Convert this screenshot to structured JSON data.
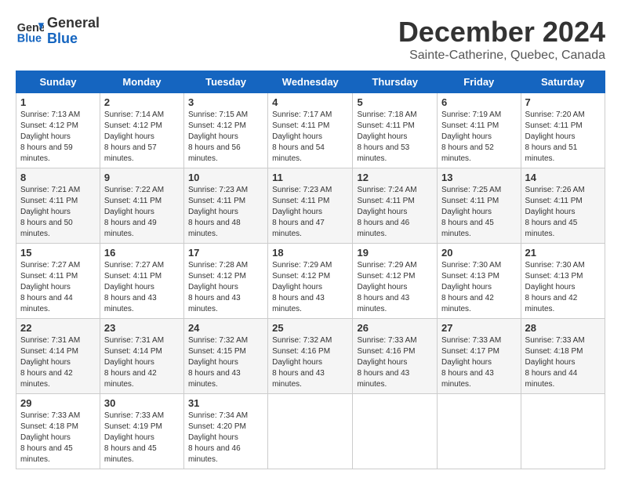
{
  "logo": {
    "line1": "General",
    "line2": "Blue"
  },
  "title": "December 2024",
  "location": "Sainte-Catherine, Quebec, Canada",
  "weekdays": [
    "Sunday",
    "Monday",
    "Tuesday",
    "Wednesday",
    "Thursday",
    "Friday",
    "Saturday"
  ],
  "weeks": [
    [
      {
        "day": "1",
        "sunrise": "7:13 AM",
        "sunset": "4:12 PM",
        "daylight": "8 hours and 59 minutes."
      },
      {
        "day": "2",
        "sunrise": "7:14 AM",
        "sunset": "4:12 PM",
        "daylight": "8 hours and 57 minutes."
      },
      {
        "day": "3",
        "sunrise": "7:15 AM",
        "sunset": "4:12 PM",
        "daylight": "8 hours and 56 minutes."
      },
      {
        "day": "4",
        "sunrise": "7:17 AM",
        "sunset": "4:11 PM",
        "daylight": "8 hours and 54 minutes."
      },
      {
        "day": "5",
        "sunrise": "7:18 AM",
        "sunset": "4:11 PM",
        "daylight": "8 hours and 53 minutes."
      },
      {
        "day": "6",
        "sunrise": "7:19 AM",
        "sunset": "4:11 PM",
        "daylight": "8 hours and 52 minutes."
      },
      {
        "day": "7",
        "sunrise": "7:20 AM",
        "sunset": "4:11 PM",
        "daylight": "8 hours and 51 minutes."
      }
    ],
    [
      {
        "day": "8",
        "sunrise": "7:21 AM",
        "sunset": "4:11 PM",
        "daylight": "8 hours and 50 minutes."
      },
      {
        "day": "9",
        "sunrise": "7:22 AM",
        "sunset": "4:11 PM",
        "daylight": "8 hours and 49 minutes."
      },
      {
        "day": "10",
        "sunrise": "7:23 AM",
        "sunset": "4:11 PM",
        "daylight": "8 hours and 48 minutes."
      },
      {
        "day": "11",
        "sunrise": "7:23 AM",
        "sunset": "4:11 PM",
        "daylight": "8 hours and 47 minutes."
      },
      {
        "day": "12",
        "sunrise": "7:24 AM",
        "sunset": "4:11 PM",
        "daylight": "8 hours and 46 minutes."
      },
      {
        "day": "13",
        "sunrise": "7:25 AM",
        "sunset": "4:11 PM",
        "daylight": "8 hours and 45 minutes."
      },
      {
        "day": "14",
        "sunrise": "7:26 AM",
        "sunset": "4:11 PM",
        "daylight": "8 hours and 45 minutes."
      }
    ],
    [
      {
        "day": "15",
        "sunrise": "7:27 AM",
        "sunset": "4:11 PM",
        "daylight": "8 hours and 44 minutes."
      },
      {
        "day": "16",
        "sunrise": "7:27 AM",
        "sunset": "4:11 PM",
        "daylight": "8 hours and 43 minutes."
      },
      {
        "day": "17",
        "sunrise": "7:28 AM",
        "sunset": "4:12 PM",
        "daylight": "8 hours and 43 minutes."
      },
      {
        "day": "18",
        "sunrise": "7:29 AM",
        "sunset": "4:12 PM",
        "daylight": "8 hours and 43 minutes."
      },
      {
        "day": "19",
        "sunrise": "7:29 AM",
        "sunset": "4:12 PM",
        "daylight": "8 hours and 43 minutes."
      },
      {
        "day": "20",
        "sunrise": "7:30 AM",
        "sunset": "4:13 PM",
        "daylight": "8 hours and 42 minutes."
      },
      {
        "day": "21",
        "sunrise": "7:30 AM",
        "sunset": "4:13 PM",
        "daylight": "8 hours and 42 minutes."
      }
    ],
    [
      {
        "day": "22",
        "sunrise": "7:31 AM",
        "sunset": "4:14 PM",
        "daylight": "8 hours and 42 minutes."
      },
      {
        "day": "23",
        "sunrise": "7:31 AM",
        "sunset": "4:14 PM",
        "daylight": "8 hours and 42 minutes."
      },
      {
        "day": "24",
        "sunrise": "7:32 AM",
        "sunset": "4:15 PM",
        "daylight": "8 hours and 43 minutes."
      },
      {
        "day": "25",
        "sunrise": "7:32 AM",
        "sunset": "4:16 PM",
        "daylight": "8 hours and 43 minutes."
      },
      {
        "day": "26",
        "sunrise": "7:33 AM",
        "sunset": "4:16 PM",
        "daylight": "8 hours and 43 minutes."
      },
      {
        "day": "27",
        "sunrise": "7:33 AM",
        "sunset": "4:17 PM",
        "daylight": "8 hours and 43 minutes."
      },
      {
        "day": "28",
        "sunrise": "7:33 AM",
        "sunset": "4:18 PM",
        "daylight": "8 hours and 44 minutes."
      }
    ],
    [
      {
        "day": "29",
        "sunrise": "7:33 AM",
        "sunset": "4:18 PM",
        "daylight": "8 hours and 45 minutes."
      },
      {
        "day": "30",
        "sunrise": "7:33 AM",
        "sunset": "4:19 PM",
        "daylight": "8 hours and 45 minutes."
      },
      {
        "day": "31",
        "sunrise": "7:34 AM",
        "sunset": "4:20 PM",
        "daylight": "8 hours and 46 minutes."
      },
      null,
      null,
      null,
      null
    ]
  ],
  "labels": {
    "sunrise": "Sunrise:",
    "sunset": "Sunset:",
    "daylight": "Daylight hours"
  }
}
